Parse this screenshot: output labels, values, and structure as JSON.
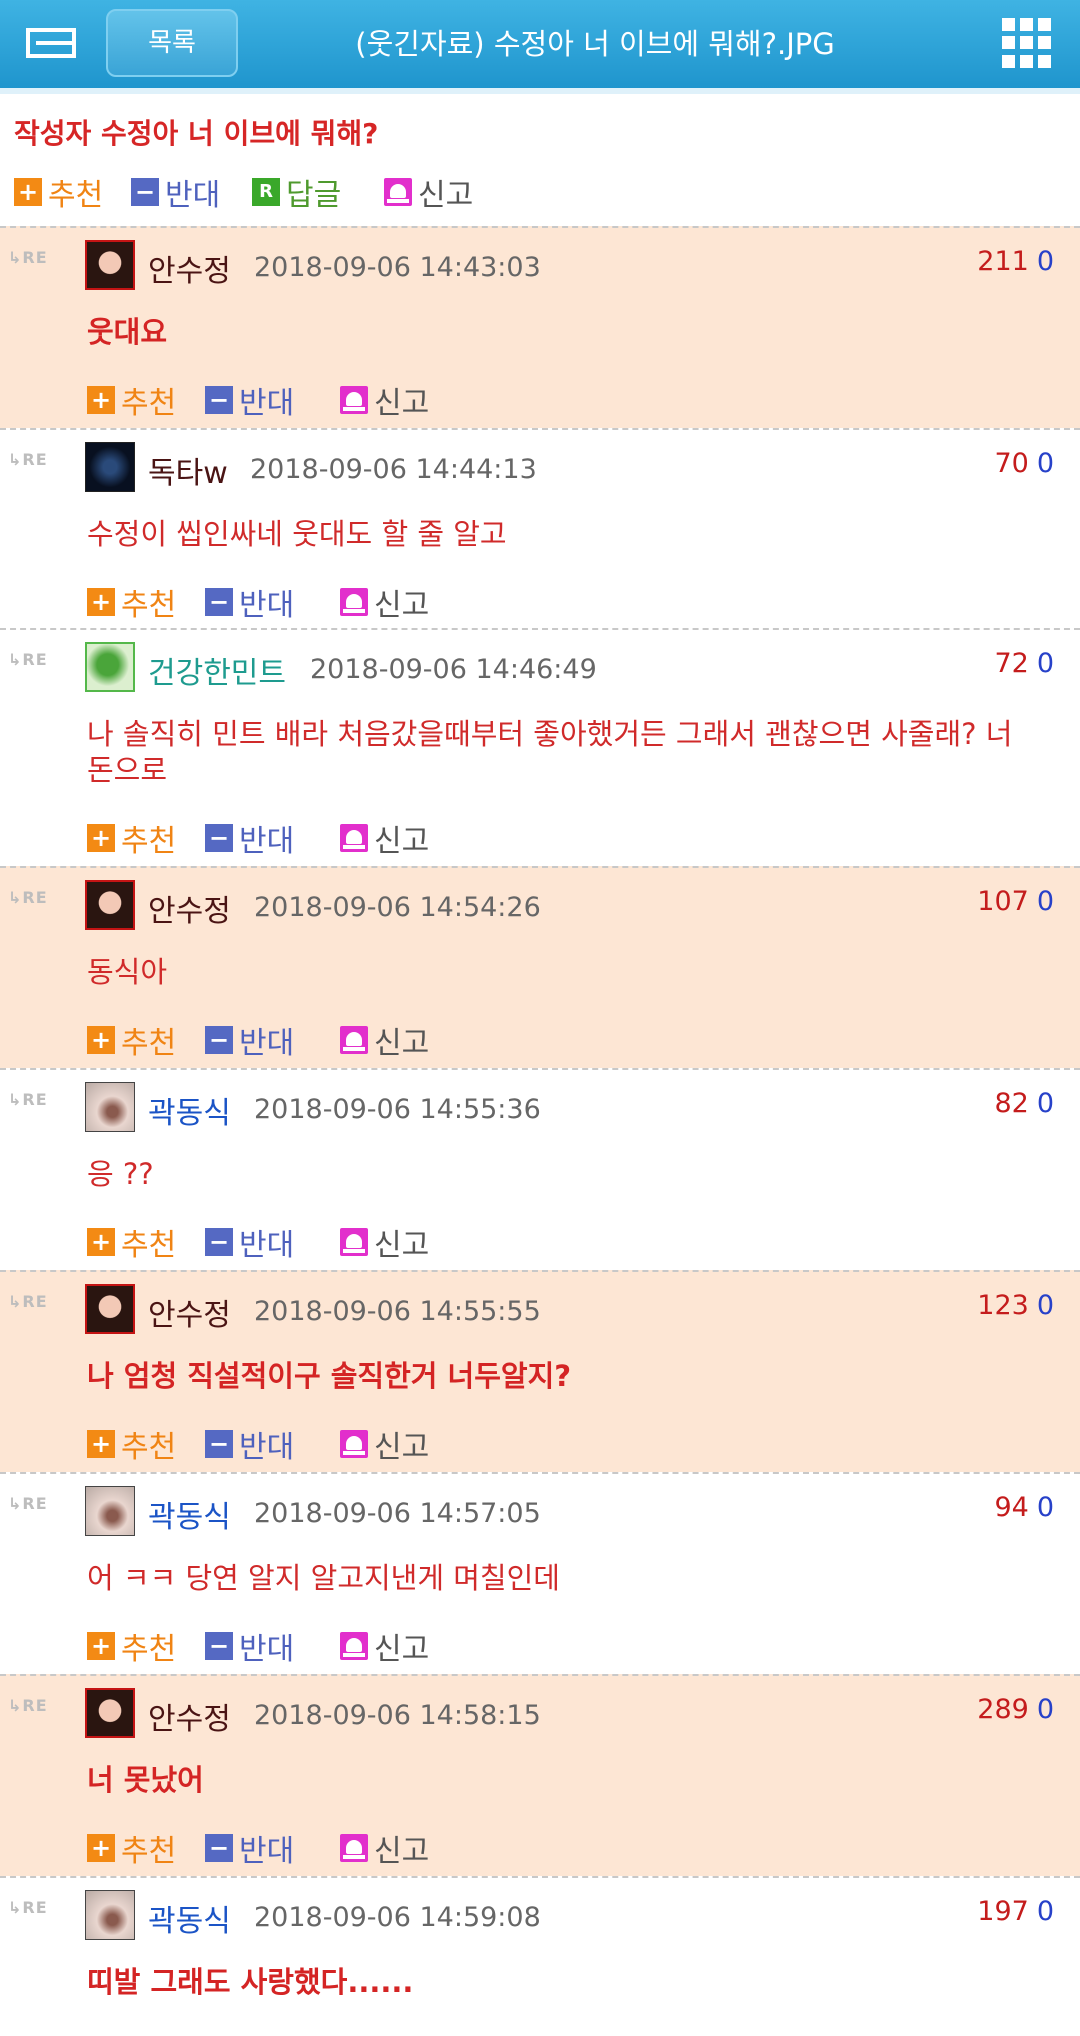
{
  "header": {
    "list_label": "목록",
    "title": "(웃긴자료) 수정아 너 이브에 뭐해?.JPG"
  },
  "post": {
    "title": "작성자 수정아 너 이브에 뭐해?",
    "recommend_label": "추천",
    "oppose_label": "반대",
    "reply_label": "답글",
    "report_label": "신고"
  },
  "comment_actions": {
    "recommend_label": "추천",
    "oppose_label": "반대",
    "report_label": "신고"
  },
  "comments": [
    {
      "re": "RE",
      "nick": "안수정",
      "time": "2018-09-06 14:43:03",
      "up": "211",
      "down": "0",
      "text": "웃대요"
    },
    {
      "re": "RE",
      "nick": "독타w",
      "time": "2018-09-06 14:44:13",
      "up": "70",
      "down": "0",
      "text": "수정이 씹인싸네 웃대도 할 줄 알고"
    },
    {
      "re": "RE",
      "nick": "건강한민트",
      "time": "2018-09-06 14:46:49",
      "up": "72",
      "down": "0",
      "text": "나 솔직히 민트 배라 처음갔을때부터 좋아했거든 그래서 괜찮으면 사줄래? 너 돈으로"
    },
    {
      "re": "RE",
      "nick": "안수정",
      "time": "2018-09-06 14:54:26",
      "up": "107",
      "down": "0",
      "text": "동식아"
    },
    {
      "re": "RE",
      "nick": "곽동식",
      "time": "2018-09-06 14:55:36",
      "up": "82",
      "down": "0",
      "text": "응 ??"
    },
    {
      "re": "RE",
      "nick": "안수정",
      "time": "2018-09-06 14:55:55",
      "up": "123",
      "down": "0",
      "text": "나 엄청 직설적이구 솔직한거 너두알지?"
    },
    {
      "re": "RE",
      "nick": "곽동식",
      "time": "2018-09-06 14:57:05",
      "up": "94",
      "down": "0",
      "text": "어 ㅋㅋ 당연 알지 알고지낸게 며칠인데"
    },
    {
      "re": "RE",
      "nick": "안수정",
      "time": "2018-09-06 14:58:15",
      "up": "289",
      "down": "0",
      "text": "너 못났어"
    },
    {
      "re": "RE",
      "nick": "곽동식",
      "time": "2018-09-06 14:59:08",
      "up": "197",
      "down": "0",
      "text": "띠발 그래도 사랑했다......"
    }
  ]
}
